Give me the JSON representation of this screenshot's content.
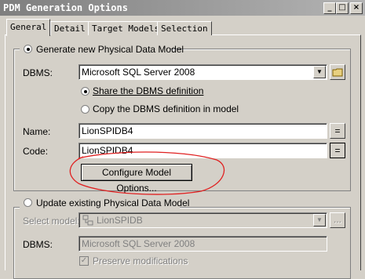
{
  "window": {
    "title": "PDM Generation Options",
    "minimize_glyph": "_",
    "maximize_glyph": "□",
    "close_glyph": "×"
  },
  "tabs": [
    {
      "label": "General"
    },
    {
      "label": "Detail"
    },
    {
      "label": "Target Models"
    },
    {
      "label": "Selection"
    }
  ],
  "generate": {
    "radio_label": "Generate new Physical Data Model",
    "dbms_label": "DBMS:",
    "dbms_value": "Microsoft SQL Server 2008",
    "share_label": "Share the DBMS definition",
    "copy_label": "Copy the DBMS definition in model",
    "name_label": "Name:",
    "name_value": "LionSPIDB4",
    "code_label": "Code:",
    "code_value": "LionSPIDB4",
    "equals_glyph": "=",
    "configure_button": "Configure Model Options..."
  },
  "update": {
    "radio_label": "Update existing Physical Data Model",
    "select_label": "Select model:",
    "select_value": "LionSPIDB",
    "browse_glyph": "...",
    "dbms_label": "DBMS:",
    "dbms_value": "Microsoft SQL Server 2008",
    "preserve_label": "Preserve modifications",
    "preserve_check": "✓"
  },
  "colors": {
    "annotation": "#e02020"
  }
}
